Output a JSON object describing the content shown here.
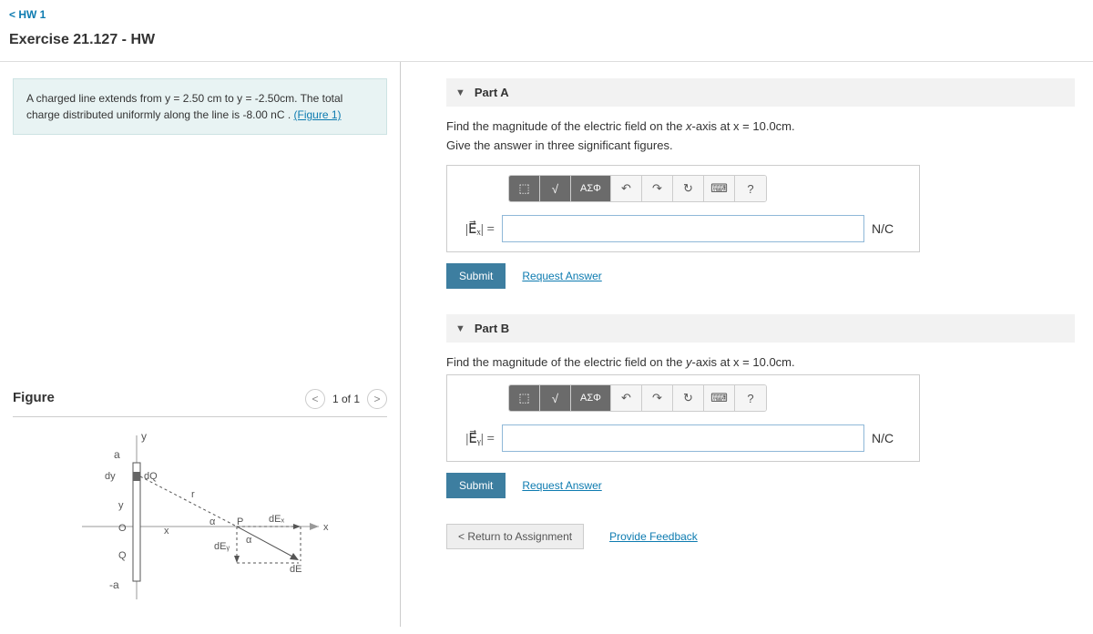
{
  "nav": {
    "back": "HW 1"
  },
  "title": "Exercise 21.127 - HW",
  "problem": {
    "text_pre": "A charged line extends from y = 2.50 cm to y = -2.50cm. The total charge distributed uniformly along the line is -8.00 nC .",
    "fig_link": "(Figure 1)"
  },
  "figure": {
    "heading": "Figure",
    "count": "1 of 1"
  },
  "parts": {
    "a": {
      "label": "Part A",
      "question_pre": "Find the magnitude of the electric field on the ",
      "axis": "x",
      "question_post": "-axis at x = 10.0cm.",
      "instr": "Give the answer in three significant figures.",
      "var_html": "|E⃗ₓ| =",
      "unit": "N/C",
      "submit": "Submit",
      "request": "Request Answer"
    },
    "b": {
      "label": "Part B",
      "question_pre": "Find the magnitude of the electric field on the ",
      "axis": "y",
      "question_post": "-axis at x = 10.0cm.",
      "var_html": "|E⃗ᵧ| =",
      "unit": "N/C",
      "submit": "Submit",
      "request": "Request Answer"
    }
  },
  "toolbar": {
    "tpl": "⬚",
    "sqrt": "√",
    "greek": "ΑΣΦ",
    "undo": "↶",
    "redo": "↷",
    "reset": "↻",
    "kbd": "⌨",
    "help": "?"
  },
  "footer": {
    "return": "Return to Assignment",
    "feedback": "Provide Feedback"
  }
}
